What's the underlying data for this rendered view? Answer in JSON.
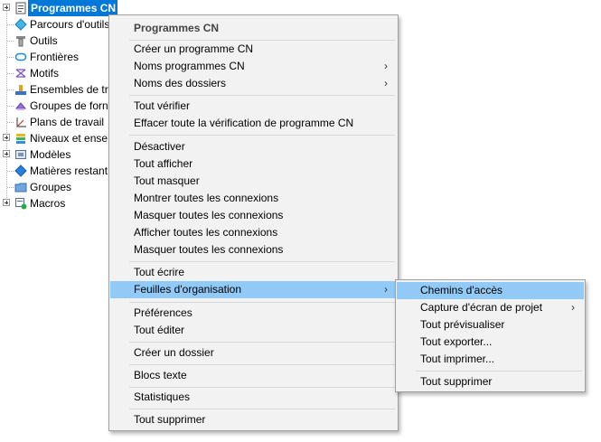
{
  "tree": {
    "items": [
      {
        "label": "Programmes CN",
        "icon": "nc-program-icon",
        "expandable": true,
        "selected": true
      },
      {
        "label": "Parcours d'outils",
        "icon": "toolpath-icon"
      },
      {
        "label": "Outils",
        "icon": "tool-icon"
      },
      {
        "label": "Frontières",
        "icon": "boundary-icon"
      },
      {
        "label": "Motifs",
        "icon": "pattern-icon"
      },
      {
        "label": "Ensembles de tr",
        "icon": "feature-set-icon"
      },
      {
        "label": "Groupes de forn",
        "icon": "feature-group-icon"
      },
      {
        "label": "Plans de travail",
        "icon": "workplane-icon"
      },
      {
        "label": "Niveaux et ense",
        "icon": "level-icon",
        "expandable": true
      },
      {
        "label": "Modèles",
        "icon": "model-icon",
        "expandable": true
      },
      {
        "label": "Matières restant",
        "icon": "stock-model-icon"
      },
      {
        "label": "Groupes",
        "icon": "group-folder-icon"
      },
      {
        "label": "Macros",
        "icon": "macro-icon",
        "expandable": true
      }
    ]
  },
  "context_menu": {
    "header": "Programmes CN",
    "items": [
      {
        "label": "Créer un programme CN"
      },
      {
        "label": "Noms programmes CN",
        "submenu": true
      },
      {
        "label": "Noms des dossiers",
        "submenu": true
      },
      {
        "label": "Tout vérifier"
      },
      {
        "label": "Effacer toute la vérification de programme CN"
      },
      {
        "label": "Désactiver"
      },
      {
        "label": "Tout afficher"
      },
      {
        "label": "Tout masquer"
      },
      {
        "label": "Montrer toutes les connexions"
      },
      {
        "label": "Masquer toutes les connexions"
      },
      {
        "label": "Afficher toutes les connexions"
      },
      {
        "label": "Masquer toutes les connexions"
      },
      {
        "label": "Tout écrire"
      },
      {
        "label": "Feuilles d'organisation",
        "submenu": true,
        "highlighted": true
      },
      {
        "label": "Préférences"
      },
      {
        "label": "Tout éditer"
      },
      {
        "label": "Créer un dossier"
      },
      {
        "label": "Blocs texte"
      },
      {
        "label": "Statistiques"
      },
      {
        "label": "Tout supprimer"
      }
    ]
  },
  "submenu": {
    "items": [
      {
        "label": "Chemins d'accès",
        "highlighted": true
      },
      {
        "label": "Capture d'écran de projet",
        "submenu": true
      },
      {
        "label": "Tout prévisualiser"
      },
      {
        "label": "Tout exporter..."
      },
      {
        "label": "Tout imprimer..."
      },
      {
        "label": "Tout supprimer"
      }
    ]
  },
  "colors": {
    "selection": "#0078d7",
    "menu_highlight": "#91c9f7",
    "menu_background": "#f2f2f2"
  }
}
